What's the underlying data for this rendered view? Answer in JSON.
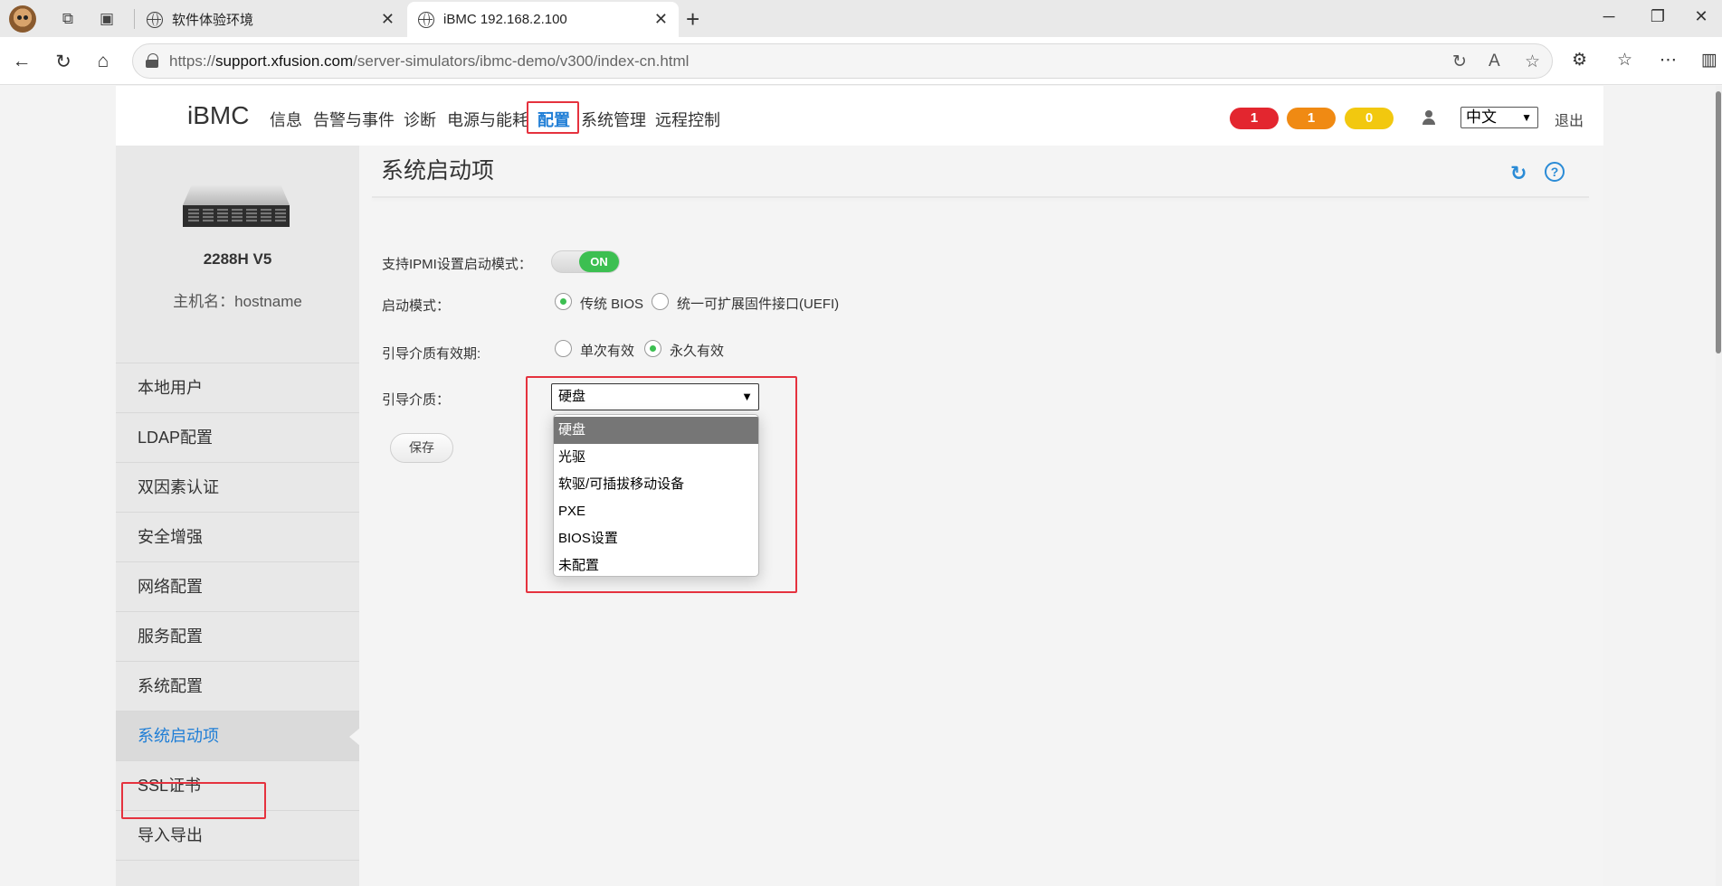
{
  "browser": {
    "tabs": [
      {
        "title": "软件体验环境",
        "close": "✕"
      },
      {
        "title": "iBMC 192.168.2.100",
        "close": "✕"
      }
    ],
    "new_tab": "+",
    "window_controls": {
      "minimize": "─",
      "restore": "❐",
      "close": "✕"
    },
    "url": {
      "scheme": "https://",
      "host": "support.xfusion.com",
      "path": "/server-simulators/ibmc-demo/v300/index-cn.html"
    }
  },
  "header": {
    "logo": "iBMC",
    "nav": [
      "信息",
      "告警与事件",
      "诊断",
      "电源与能耗",
      "配置",
      "系统管理",
      "远程控制"
    ],
    "active_nav": "配置",
    "alarms": [
      {
        "count": "1",
        "color": "#e3262f"
      },
      {
        "count": "1",
        "color": "#f08a13"
      },
      {
        "count": "0",
        "color": "#f2c80f"
      }
    ],
    "language": "中文",
    "logout": "退出"
  },
  "sidebar": {
    "model": "2288H V5",
    "hostname_label": "主机名：",
    "hostname": "hostname",
    "items": [
      "本地用户",
      "LDAP配置",
      "双因素认证",
      "安全增强",
      "网络配置",
      "服务配置",
      "系统配置",
      "系统启动项",
      "SSL证书",
      "导入导出"
    ],
    "active_item": "系统启动项"
  },
  "content": {
    "title": "系统启动项",
    "ipmi_label": "支持IPMI设置启动模式：",
    "ipmi_toggle": "ON",
    "boot_mode_label": "启动模式：",
    "boot_mode_options": [
      "传统 BIOS",
      "统一可扩展固件接口(UEFI)"
    ],
    "boot_mode_selected": "传统 BIOS",
    "validity_label": "引导介质有效期:",
    "validity_options": [
      "单次有效",
      "永久有效"
    ],
    "validity_selected": "永久有效",
    "media_label": "引导介质：",
    "media_value": "硬盘",
    "media_options": [
      "硬盘",
      "光驱",
      "软驱/可插拔移动设备",
      "PXE",
      "BIOS设置",
      "未配置"
    ],
    "save_button": "保存"
  },
  "colors": {
    "accent": "#1f7ed6",
    "toggle_on": "#3cbf51",
    "highlight_box": "#e5323e"
  }
}
